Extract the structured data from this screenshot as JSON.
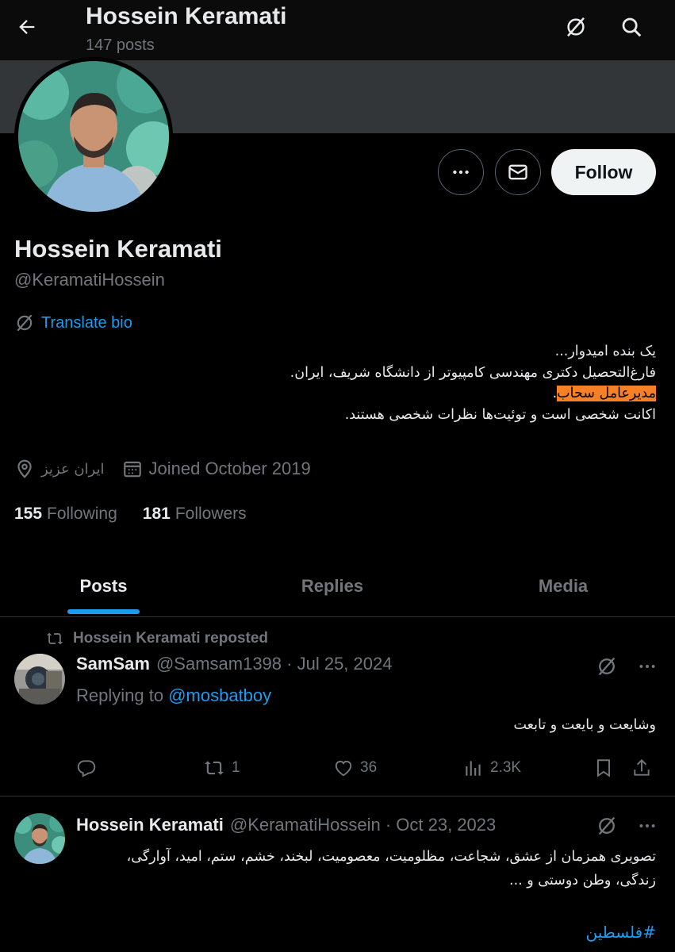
{
  "header": {
    "title": "Hossein Keramati",
    "posts_count": "147 posts",
    "back_icon": "back-arrow-icon",
    "translate_icon": "translate-icon",
    "search_icon": "search-icon"
  },
  "profile": {
    "name": "Hossein Keramati",
    "handle": "@KeramatiHossein",
    "follow_label": "Follow",
    "translate_label": "Translate bio",
    "bio_line1": "یک بنده امیدوار...",
    "bio_line2": "فارغ‌التحصیل دکتری مهندسی کامپیوتر از دانشگاه شریف، ایران.",
    "bio_line3_highlight": "مدیرعامل سحاب",
    "bio_line3_tail": ".",
    "bio_line4": "اکانت شخصی است و توئیت‌ها نظرات شخصی هستند.",
    "location": "ایران عزیز",
    "joined": "Joined October 2019",
    "following_count": "155",
    "following_label": "Following",
    "followers_count": "181",
    "followers_label": "Followers",
    "highlight_color": "#f58025"
  },
  "tabs": [
    {
      "label": "Posts",
      "active": true
    },
    {
      "label": "Replies",
      "active": false
    },
    {
      "label": "Media",
      "active": false
    }
  ],
  "posts": [
    {
      "repost_label": "Hossein Keramati reposted",
      "display_name": "SamSam",
      "username": "@Samsam1398",
      "date": "Jul 25, 2024",
      "replying_prefix": "Replying to",
      "replying_to": "@mosbatboy",
      "text": "وشایعت و بایعت و تابعت",
      "reposts": "1",
      "likes": "36",
      "views": "2.3K"
    },
    {
      "display_name": "Hossein Keramati",
      "username": "@KeramatiHossein",
      "date": "Oct 23, 2023",
      "text_line1": "تصویری همزمان از عشق، شجاعت، مظلومیت، معصومیت،  لبخند، خشم، ستم، امید، آوارگی،",
      "text_line2": "زندگی، وطن دوستی و ...",
      "hashtag": "#فلسطین"
    }
  ],
  "colors": {
    "accent": "#1d9bf0",
    "background": "#000000",
    "muted": "#71767b",
    "text": "#e7e9ea"
  }
}
